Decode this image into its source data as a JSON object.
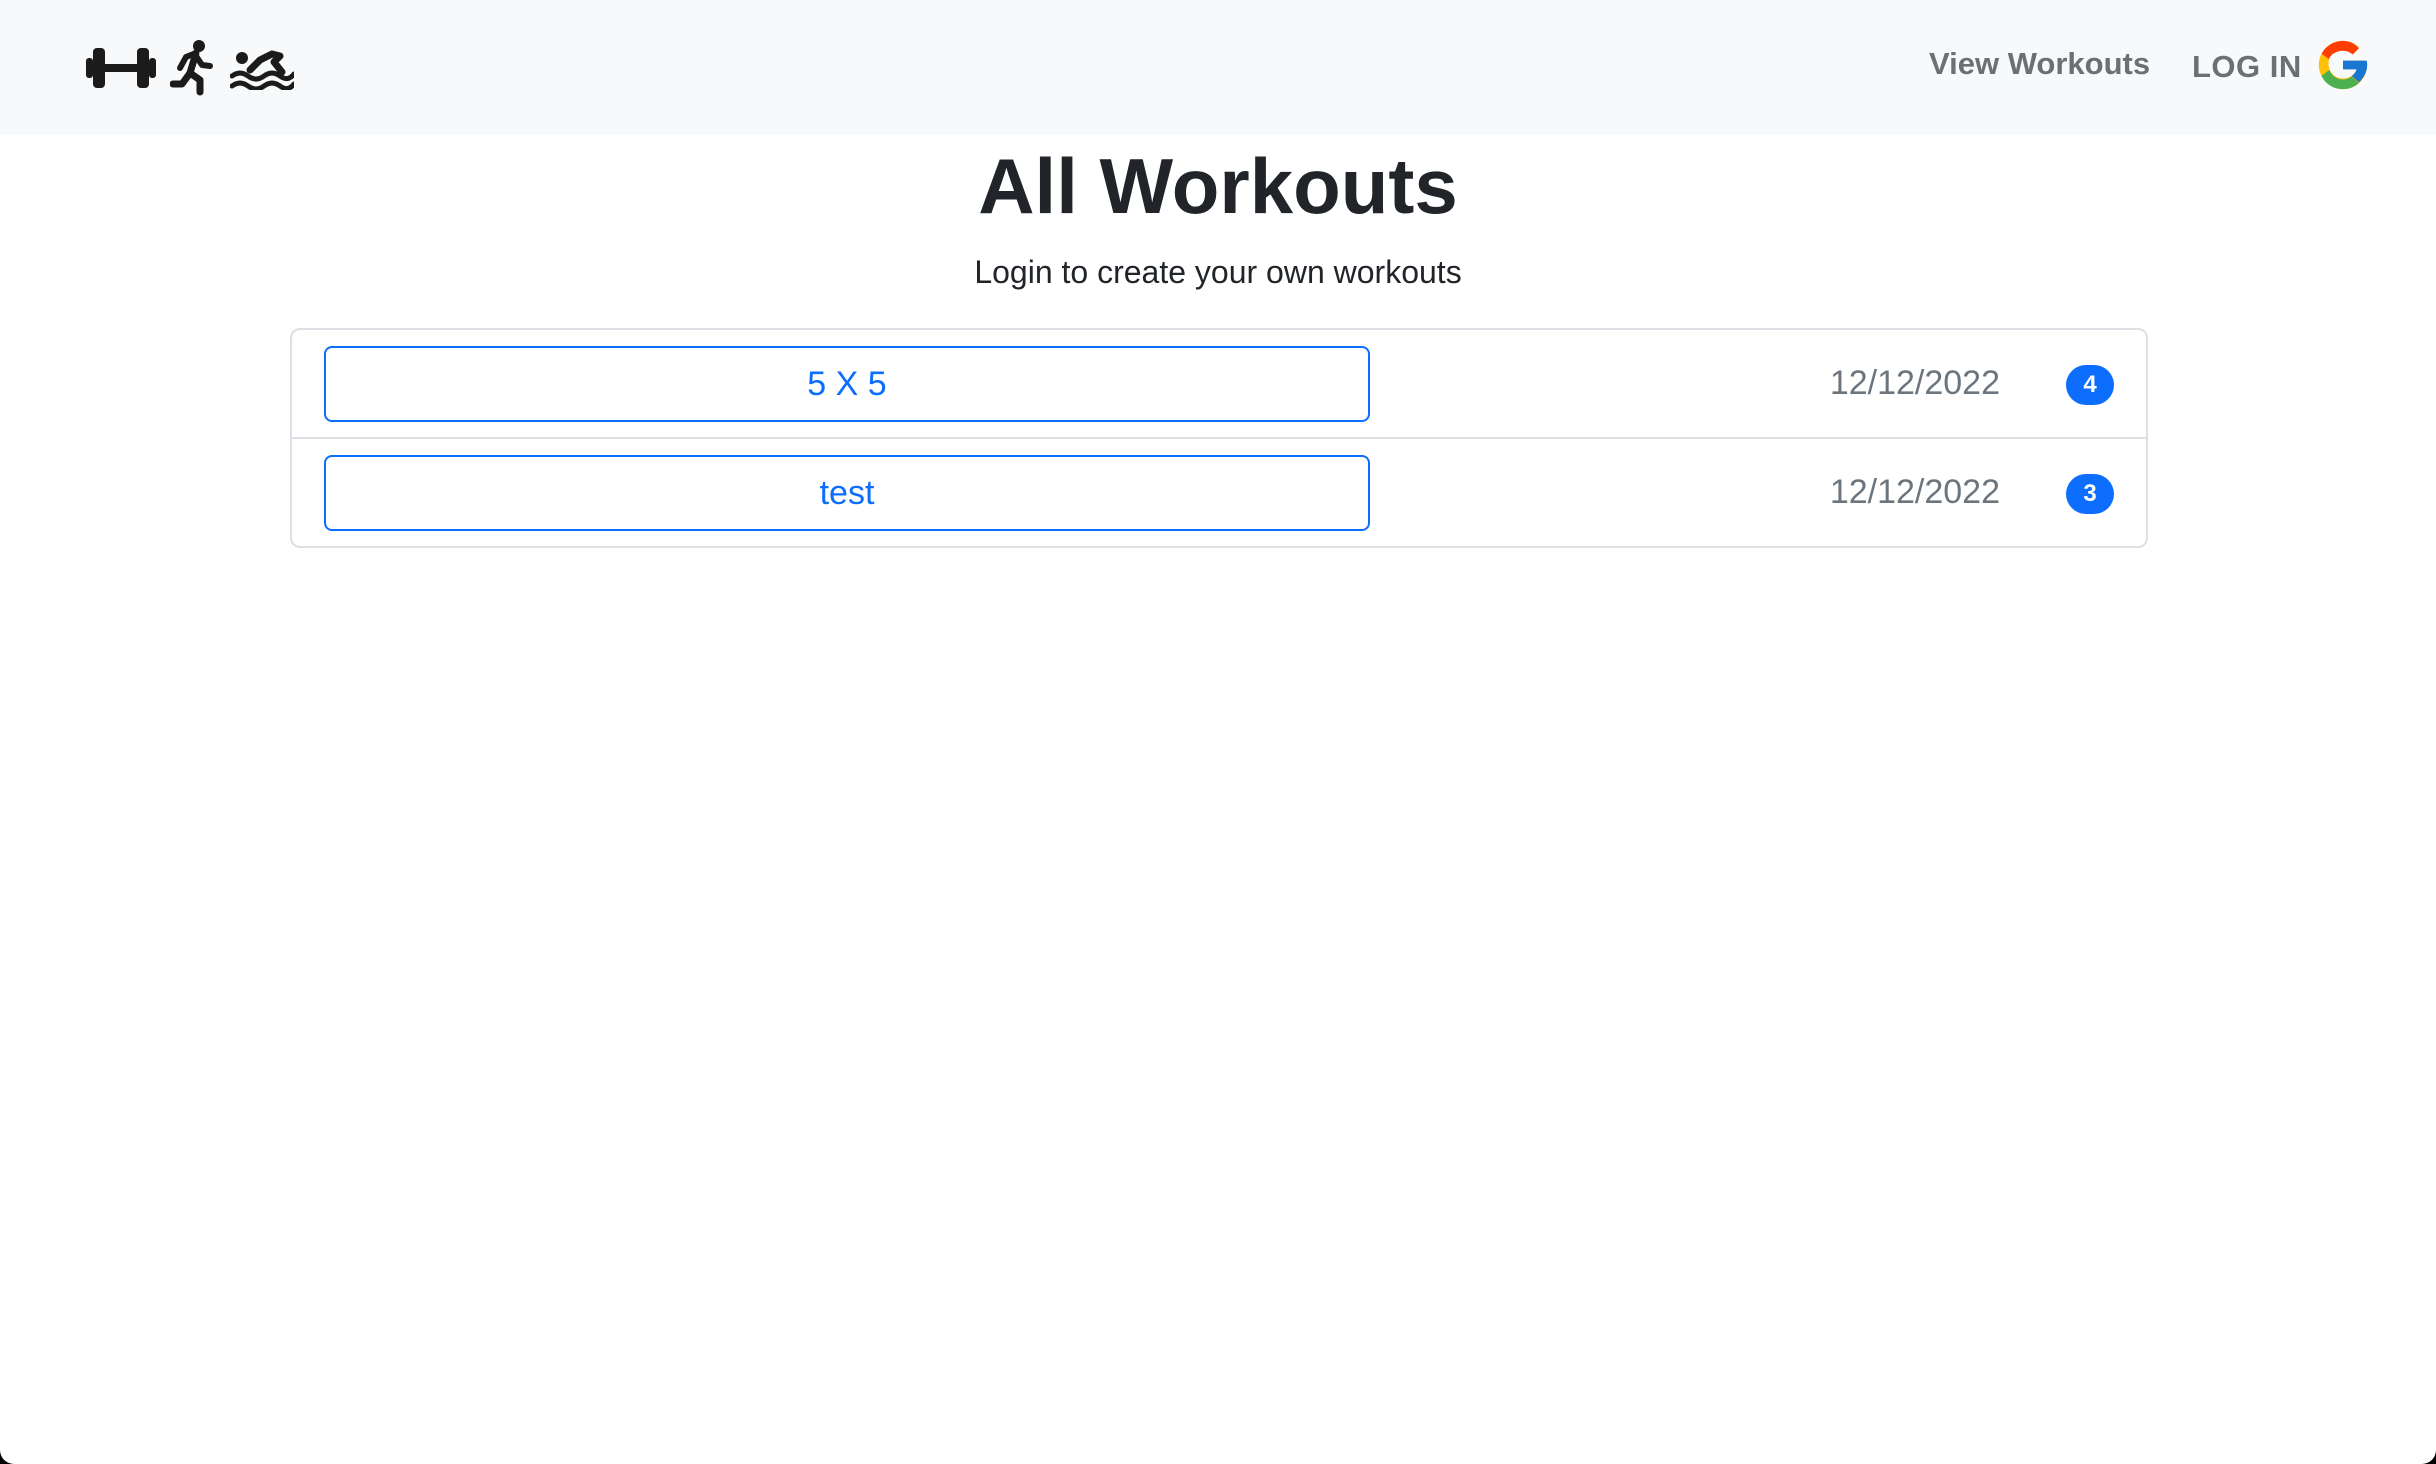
{
  "nav": {
    "brand_icons": [
      "dumbbell-icon",
      "running-person-icon",
      "swimmer-icon"
    ],
    "view_workouts_label": "View Workouts",
    "login_label": "LOG IN",
    "login_icon": "google-g-icon"
  },
  "page": {
    "title": "All Workouts",
    "subtitle": "Login to create your own workouts"
  },
  "workouts": [
    {
      "name": "5 X 5",
      "date": "12/12/2022",
      "count": "4"
    },
    {
      "name": "test",
      "date": "12/12/2022",
      "count": "3"
    }
  ],
  "colors": {
    "primary": "#0d6efd",
    "navbar_bg": "#f8f9fa",
    "muted_text": "#6c757d"
  }
}
